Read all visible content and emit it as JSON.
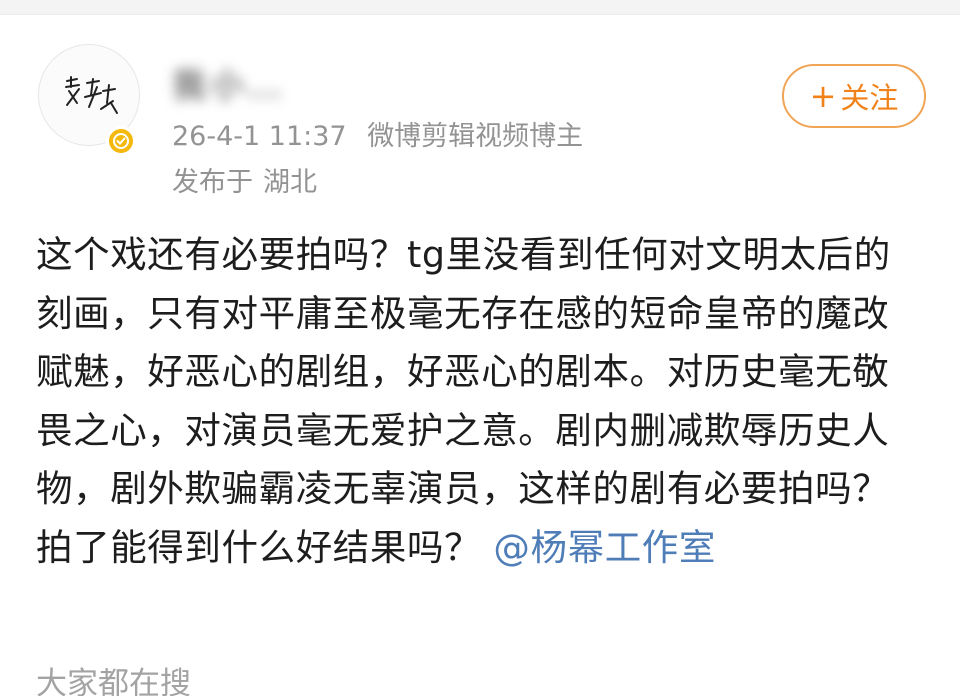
{
  "author": {
    "name": "我小…",
    "date": "26-4-1 11:37",
    "role": "微博剪辑视频博主",
    "location_prefix": "发布于",
    "location": "湖北",
    "avatar_text": "吴灏"
  },
  "follow_button": {
    "plus": "+",
    "label": "关注"
  },
  "post": {
    "text": "这个戏还有必要拍吗？tg里没看到任何对文明太后的刻画，只有对平庸至极毫无存在感的短命皇帝的魔改赋魅，好恶心的剧组，好恶心的剧本。对历史毫无敬畏之心，对演员毫无爱护之意。剧内删减欺辱历史人物，剧外欺骗霸凌无辜演员，这样的剧有必要拍吗？拍了能得到什么好结果吗？",
    "mention": "@杨幂工作室"
  },
  "trending": {
    "label": "大家都在搜"
  },
  "colors": {
    "accent": "#f08219",
    "mention": "#4f7db8",
    "meta": "#939393",
    "verified": "#f5b80d"
  },
  "icons": {
    "verified": "verified-badge-icon",
    "follow": "plus-icon"
  }
}
